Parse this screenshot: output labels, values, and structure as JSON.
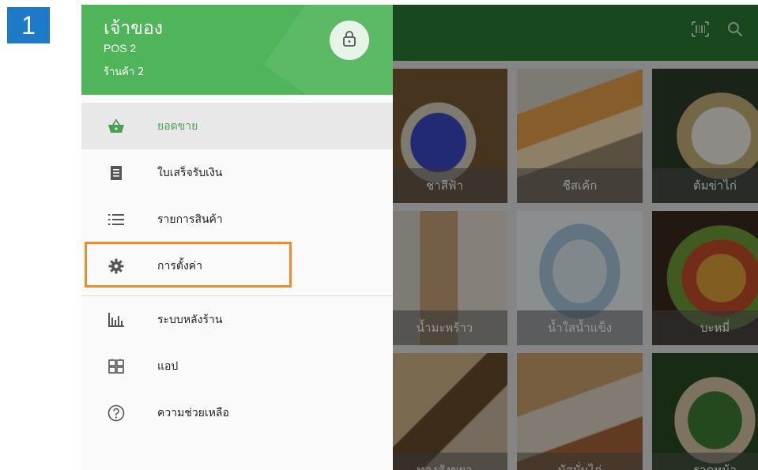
{
  "step": {
    "number": "1",
    "color": "#1c7ac6"
  },
  "header": {
    "background": "#2b7d36",
    "icons": [
      "barcode-scan-icon",
      "search-icon"
    ]
  },
  "drawer": {
    "header_color": "#4fb45a",
    "owner": "เจ้าของ",
    "pos": "POS 2",
    "store": "ร้านค้า 2",
    "lock_icon": "lock-icon",
    "items": [
      {
        "label": "ยอดขาย",
        "icon": "basket-icon",
        "active": true
      },
      {
        "label": "ใบเสร็จรับเงิน",
        "icon": "receipt-icon",
        "active": false
      },
      {
        "label": "รายการสินค้า",
        "icon": "list-icon",
        "active": false
      },
      {
        "label": "การตั้งค่า",
        "icon": "gear-icon",
        "active": false,
        "highlighted": true
      },
      {
        "label": "ระบบหลังร้าน",
        "icon": "bar-chart-icon",
        "active": false
      },
      {
        "label": "แอป",
        "icon": "apps-icon",
        "active": false
      },
      {
        "label": "ความช่วยเหลือ",
        "icon": "help-icon",
        "active": false
      }
    ]
  },
  "highlight_color": "#f08a2c",
  "products": [
    {
      "name": "ชาสีฟ้า"
    },
    {
      "name": "ชีสเค้ก"
    },
    {
      "name": "ต้มข่าไก่"
    },
    {
      "name": "น้ำมะพร้าว"
    },
    {
      "name": "น้ำใสน้ำแข็ง"
    },
    {
      "name": "บะหมี่"
    },
    {
      "name": "ทองสังขยา"
    },
    {
      "name": "มัสมั่นไก่"
    },
    {
      "name": "ราดหน้า"
    }
  ]
}
